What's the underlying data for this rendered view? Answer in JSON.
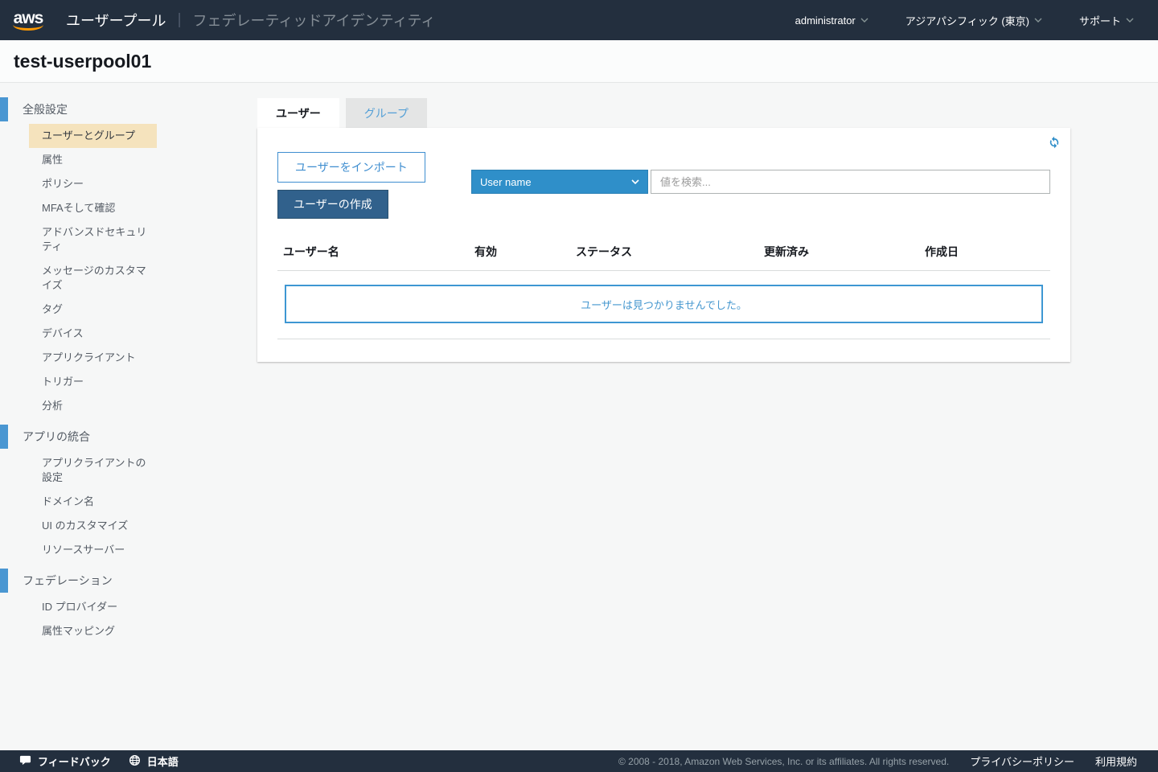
{
  "header": {
    "logo_text": "aws",
    "service_title": "ユーザープール",
    "service_secondary": "フェデレーティッドアイデンティティ",
    "user_menu": "administrator",
    "region_menu": "アジアパシフィック (東京)",
    "support_menu": "サポート"
  },
  "page": {
    "title": "test-userpool01"
  },
  "sidebar": {
    "sections": [
      {
        "label": "全般設定",
        "items": [
          {
            "label": "ユーザーとグループ",
            "active": true
          },
          {
            "label": "属性"
          },
          {
            "label": "ポリシー"
          },
          {
            "label": "MFAそして確認"
          },
          {
            "label": "アドバンスドセキュリティ"
          },
          {
            "label": "メッセージのカスタマイズ"
          },
          {
            "label": "タグ"
          },
          {
            "label": "デバイス"
          },
          {
            "label": "アプリクライアント"
          },
          {
            "label": "トリガー"
          },
          {
            "label": "分析"
          }
        ]
      },
      {
        "label": "アプリの統合",
        "items": [
          {
            "label": "アプリクライアントの設定"
          },
          {
            "label": "ドメイン名"
          },
          {
            "label": "UI のカスタマイズ"
          },
          {
            "label": "リソースサーバー"
          }
        ]
      },
      {
        "label": "フェデレーション",
        "items": [
          {
            "label": "ID プロバイダー"
          },
          {
            "label": "属性マッピング"
          }
        ]
      }
    ]
  },
  "main": {
    "tabs": [
      {
        "label": "ユーザー",
        "active": true
      },
      {
        "label": "グループ",
        "active": false
      }
    ],
    "toolbar": {
      "import_button": "ユーザーをインポート",
      "create_button": "ユーザーの作成",
      "filter_selected": "User name",
      "search_placeholder": "値を検索..."
    },
    "table": {
      "columns": [
        "ユーザー名",
        "有効",
        "ステータス",
        "更新済み",
        "作成日"
      ],
      "empty_message": "ユーザーは見つかりませんでした。"
    }
  },
  "footer": {
    "feedback_label": "フィードバック",
    "language_label": "日本語",
    "copyright": "© 2008 - 2018, Amazon Web Services, Inc. or its affiliates. All rights reserved.",
    "privacy_label": "プライバシーポリシー",
    "terms_label": "利用規約"
  },
  "icons": {
    "logo_swoosh": "aws-smile-swoosh",
    "chevron": "chevron-down",
    "refresh": "refresh-circular-arrows",
    "feedback": "speech-bubble",
    "language": "globe"
  },
  "colors": {
    "navbar_bg": "#232f3e",
    "logo_orange": "#ff9900",
    "accent_blue": "#2e8dc8",
    "active_item_bg": "#f5e3bd",
    "section_bar_blue": "#4a97d2",
    "create_button_bg": "#31618c",
    "import_button_blue": "#3f8ed0",
    "empty_border_blue": "#3e97d3",
    "inactive_tab_bg": "#e4e5e5"
  }
}
